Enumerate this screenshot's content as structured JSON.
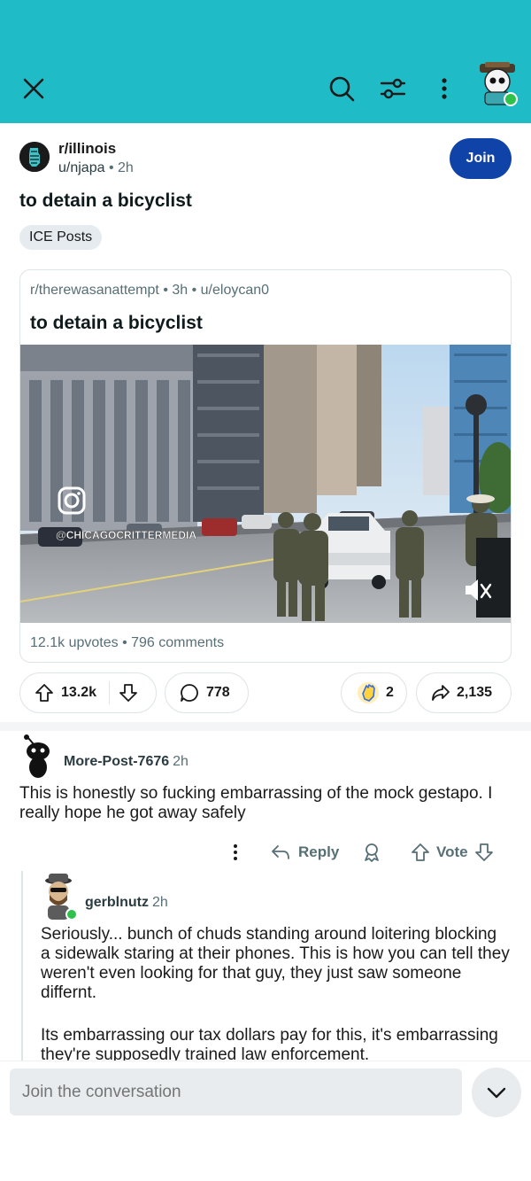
{
  "colors": {
    "topbar": "#1fbcc8",
    "join_button": "#0f43a8",
    "online": "#2ec24a",
    "muted_text": "#576f76"
  },
  "topbar": {
    "icons": [
      "close-icon",
      "search-icon",
      "filter-icon",
      "more-icon",
      "avatar"
    ]
  },
  "post": {
    "subreddit": "r/illinois",
    "author": "u/njapa",
    "time": "2h",
    "join_label": "Join",
    "title": "to detain a bicyclist",
    "flair": "ICE Posts"
  },
  "crosspost": {
    "subreddit": "r/therewasanattempt",
    "time": "3h",
    "author": "u/eloycan0",
    "title": "to detain a bicyclist",
    "watermark": "@CHICAGOCRITTERMEDIA",
    "upvotes": "12.1k upvotes",
    "comments": "796 comments"
  },
  "actions": {
    "score": "13.2k",
    "comments": "778",
    "awards": "2",
    "shares": "2,135"
  },
  "comments": [
    {
      "user": "More-Post-7676",
      "time": "2h",
      "body": "This is honestly so fucking embarrassing of the mock gestapo. I really hope he got away safely",
      "reply_label": "Reply",
      "vote_label": "Vote"
    },
    {
      "user": "gerblnutz",
      "time": "2h",
      "body1": "Seriously... bunch of chuds standing around loitering blocking a sidewalk staring at their phones. This is how you can tell they weren't even looking for that guy, they just saw someone differnt.",
      "body2": "Its embarrassing our tax dollars pay for this, it's embarrassing they're supposedly trained law enforcement."
    }
  ],
  "composer": {
    "placeholder": "Join the conversation"
  }
}
